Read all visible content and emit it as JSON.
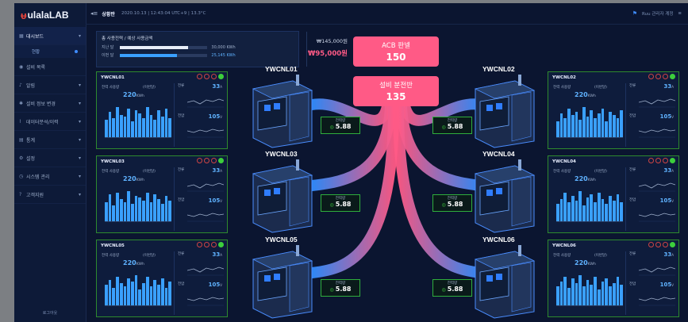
{
  "app": {
    "logo": "ulalaLAB"
  },
  "sidebar": {
    "items": [
      {
        "icon": "grid-icon",
        "label": "대시보드",
        "active": true
      },
      {
        "icon": "user-icon",
        "label": "설비 목록"
      },
      {
        "icon": "bell-icon",
        "label": "알림"
      },
      {
        "icon": "gear-icon",
        "label": "설비 정보 변경"
      },
      {
        "icon": "chart-icon",
        "label": "데이터분석/이력"
      },
      {
        "icon": "doc-icon",
        "label": "통계"
      },
      {
        "icon": "cog-icon",
        "label": "설정"
      },
      {
        "icon": "clock-icon",
        "label": "시스템 관리"
      },
      {
        "icon": "help-icon",
        "label": "고객지원"
      }
    ],
    "sub_item": "현황",
    "logout": "로그아웃"
  },
  "topbar": {
    "title": "상황판",
    "info": "2020.10.13  |  12:43:04 UTC+9  |  13.3°C",
    "user": "Ruu 관리자 계정"
  },
  "usage": {
    "title": "총 사용전력 / 예상 사용금액",
    "rows": [
      {
        "label": "지난 달",
        "value": "30,000 KWh",
        "fill": 0.78,
        "color": "#e8eef8"
      },
      {
        "label": "이번 달",
        "value": "25,145 KWh",
        "fill": 0.65,
        "color": "#3aa0ff"
      }
    ],
    "cost_prev": "₩145,000원",
    "cost_now": "₩95,000원"
  },
  "hub": {
    "acb": {
      "label": "ACB 판넬",
      "value": "150"
    },
    "dist": {
      "label": "설비 분전반",
      "value": "135"
    }
  },
  "machines": [
    {
      "name": "YWCNL01",
      "meter_label": "전력량",
      "meter_value": "5.88"
    },
    {
      "name": "YWCNL02",
      "meter_label": "전력량",
      "meter_value": "5.88"
    },
    {
      "name": "YWCNL03",
      "meter_label": "전력량",
      "meter_value": "5.88"
    },
    {
      "name": "YWCNL04",
      "meter_label": "전력량",
      "meter_value": "5.88"
    },
    {
      "name": "YWCNL05",
      "meter_label": "전력량",
      "meter_value": "5.88"
    },
    {
      "name": "YWCNL06",
      "meter_label": "전력량",
      "meter_value": "5.88"
    }
  ],
  "panels": [
    {
      "name": "YWCNL01",
      "l1": "전력 사용량",
      "l2": "(이번달)",
      "big": "220",
      "unit": "KWh",
      "r1_label": "전류",
      "r1": "33",
      "r1_unit": "A",
      "r2_label": "전압",
      "r2": "105",
      "r2_unit": "V",
      "bars": [
        0.55,
        0.8,
        0.6,
        0.95,
        0.7,
        0.65,
        0.9,
        0.5,
        0.85,
        0.75,
        0.6,
        0.95,
        0.7,
        0.55,
        0.85,
        0.65,
        0.9,
        0.6
      ]
    },
    {
      "name": "YWCNL02",
      "l1": "전력 사용량",
      "l2": "(이번달)",
      "big": "220",
      "unit": "KWh",
      "r1_label": "전류",
      "r1": "33",
      "r1_unit": "A",
      "r2_label": "전압",
      "r2": "105",
      "r2_unit": "V",
      "bars": [
        0.5,
        0.75,
        0.6,
        0.9,
        0.7,
        0.8,
        0.55,
        0.95,
        0.65,
        0.85,
        0.6,
        0.75,
        0.9,
        0.5,
        0.8,
        0.7,
        0.6,
        0.85
      ]
    },
    {
      "name": "YWCNL03",
      "l1": "전력 사용량",
      "l2": "(이번달)",
      "big": "220",
      "unit": "KWh",
      "r1_label": "전류",
      "r1": "33",
      "r1_unit": "A",
      "r2_label": "전압",
      "r2": "105",
      "r2_unit": "V",
      "bars": [
        0.6,
        0.85,
        0.5,
        0.9,
        0.7,
        0.6,
        0.95,
        0.55,
        0.8,
        0.75,
        0.65,
        0.9,
        0.6,
        0.85,
        0.7,
        0.55,
        0.8,
        0.65
      ]
    },
    {
      "name": "YWCNL04",
      "l1": "전력 사용량",
      "l2": "(이번달)",
      "big": "220",
      "unit": "KWh",
      "r1_label": "전류",
      "r1": "33",
      "r1_unit": "A",
      "r2_label": "전압",
      "r2": "105",
      "r2_unit": "V",
      "bars": [
        0.55,
        0.7,
        0.9,
        0.6,
        0.8,
        0.65,
        0.95,
        0.5,
        0.75,
        0.85,
        0.6,
        0.9,
        0.7,
        0.55,
        0.8,
        0.65,
        0.85,
        0.6
      ]
    },
    {
      "name": "YWCNL05",
      "l1": "전력 사용량",
      "l2": "(이번달)",
      "big": "220",
      "unit": "KWh",
      "r1_label": "전류",
      "r1": "33",
      "r1_unit": "A",
      "r2_label": "전압",
      "r2": "105",
      "r2_unit": "V",
      "bars": [
        0.65,
        0.8,
        0.55,
        0.9,
        0.7,
        0.6,
        0.85,
        0.75,
        0.95,
        0.5,
        0.7,
        0.9,
        0.6,
        0.8,
        0.65,
        0.85,
        0.55,
        0.75
      ]
    },
    {
      "name": "YWCNL06",
      "l1": "전력 사용량",
      "l2": "(이번달)",
      "big": "220",
      "unit": "KWh",
      "r1_label": "전류",
      "r1": "33",
      "r1_unit": "A",
      "r2_label": "전압",
      "r2": "105",
      "r2_unit": "V",
      "bars": [
        0.6,
        0.75,
        0.9,
        0.55,
        0.85,
        0.7,
        0.95,
        0.6,
        0.8,
        0.65,
        0.9,
        0.5,
        0.75,
        0.85,
        0.6,
        0.7,
        0.9,
        0.65
      ]
    }
  ]
}
